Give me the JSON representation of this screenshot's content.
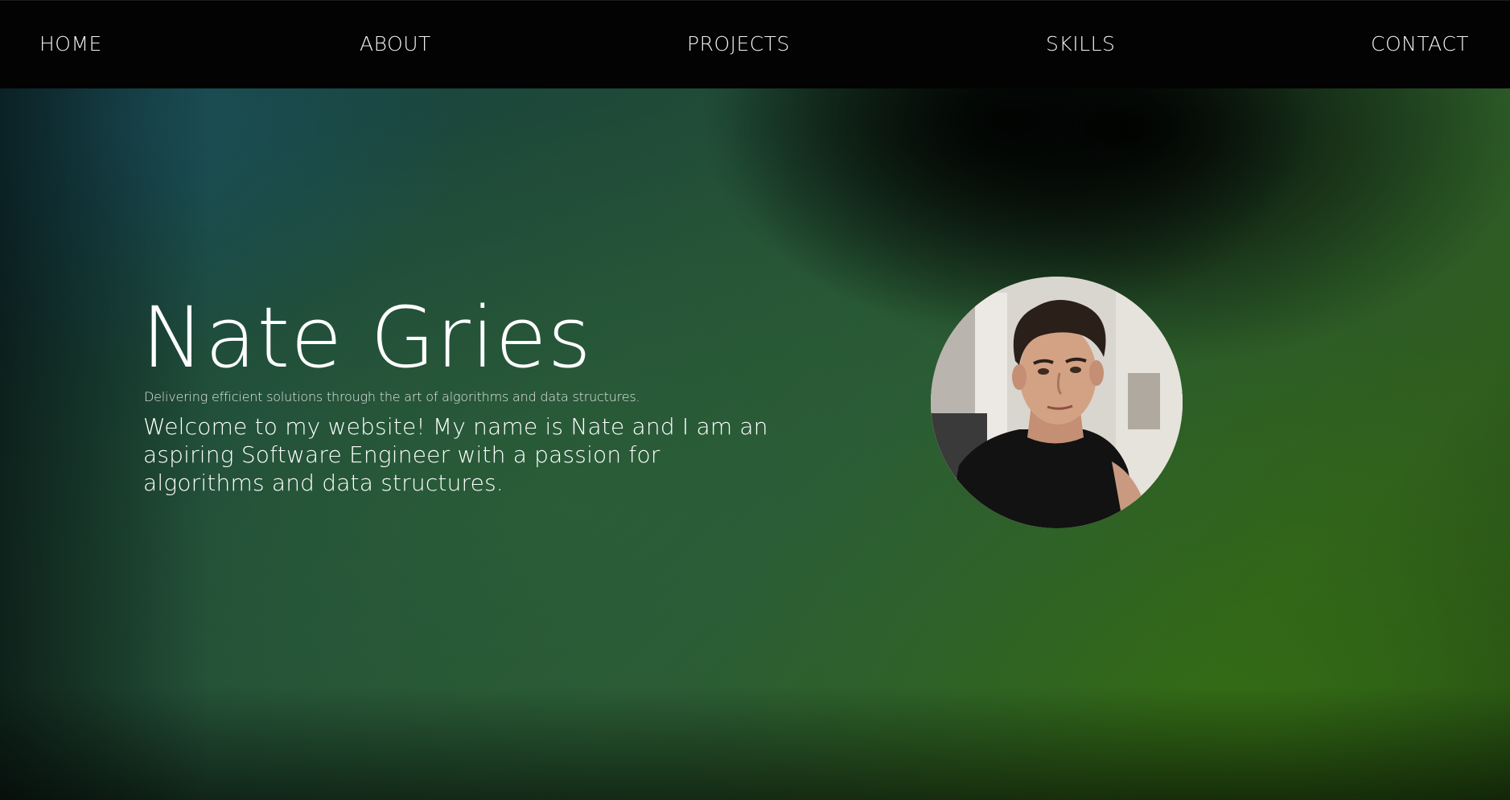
{
  "nav": {
    "items": [
      {
        "label": "HOME"
      },
      {
        "label": "ABOUT"
      },
      {
        "label": "PROJECTS"
      },
      {
        "label": "SKILLS"
      },
      {
        "label": "CONTACT"
      }
    ]
  },
  "hero": {
    "name": "Nate Gries",
    "tagline": "Delivering efficient solutions through the art of algorithms and data structures.",
    "intro": "Welcome to my website! My name is Nate and I am an aspiring Software Engineer with a passion for algorithms and data structures."
  },
  "colors": {
    "nav_background": "#030303",
    "text": "#ffffff",
    "gradient_teal": "#1c525c",
    "gradient_green": "#346e14"
  }
}
